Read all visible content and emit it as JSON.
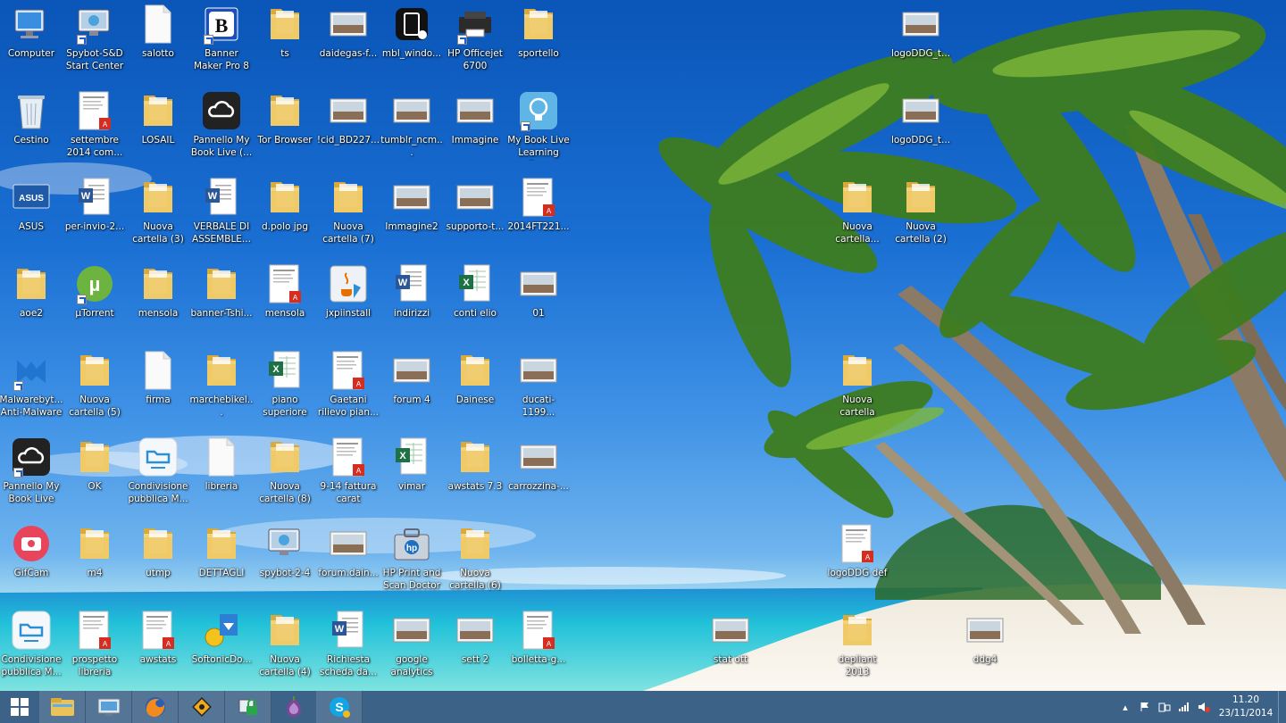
{
  "desktop_icons": [
    {
      "label": "Computer",
      "icon": "computer-icon",
      "shortcut": false
    },
    {
      "label": "Spybot-S&D Start Center",
      "icon": "spybot-icon",
      "shortcut": true
    },
    {
      "label": "salotto",
      "icon": "document-icon",
      "shortcut": false
    },
    {
      "label": "Banner Maker Pro 8",
      "icon": "banner-maker-icon",
      "shortcut": true
    },
    {
      "label": "ts",
      "icon": "folder-icon",
      "shortcut": false
    },
    {
      "label": "daidegas-f...",
      "icon": "image-icon",
      "shortcut": false
    },
    {
      "label": "mbl_windo...",
      "icon": "app-icon",
      "shortcut": false
    },
    {
      "label": "HP Officejet 6700",
      "icon": "printer-icon",
      "shortcut": true
    },
    {
      "label": "sportello",
      "icon": "folder-icon",
      "shortcut": false
    },
    {
      "label": "logoDDG_t...",
      "icon": "image-icon",
      "shortcut": false
    },
    {
      "label": "Cestino",
      "icon": "recycle-bin-icon",
      "shortcut": false
    },
    {
      "label": "settembre 2014 com...",
      "icon": "pdf-icon",
      "shortcut": false
    },
    {
      "label": "LOSAIL",
      "icon": "folder-icon",
      "shortcut": false
    },
    {
      "label": "Pannello My Book Live (...",
      "icon": "cloud-icon",
      "shortcut": false
    },
    {
      "label": "Tor Browser",
      "icon": "folder-icon",
      "shortcut": false
    },
    {
      "label": "!cid_BD227...",
      "icon": "image-icon",
      "shortcut": false
    },
    {
      "label": "tumblr_ncm...",
      "icon": "image-icon",
      "shortcut": false
    },
    {
      "label": "Immagine",
      "icon": "image-icon",
      "shortcut": false
    },
    {
      "label": "My Book Live Learning Ce...",
      "icon": "lightbulb-icon",
      "shortcut": true
    },
    {
      "label": "logoDDG_t...",
      "icon": "image-icon",
      "shortcut": false
    },
    {
      "label": "ASUS",
      "icon": "asus-icon",
      "shortcut": false
    },
    {
      "label": "per-invio-2...",
      "icon": "word-icon",
      "shortcut": false
    },
    {
      "label": "Nuova cartella (3)",
      "icon": "folder-icon",
      "shortcut": false
    },
    {
      "label": "VERBALE DI ASSEMBLE...",
      "icon": "word-icon",
      "shortcut": false
    },
    {
      "label": "d.polo jpg",
      "icon": "folder-icon",
      "shortcut": false
    },
    {
      "label": "Nuova cartella (7)",
      "icon": "folder-icon",
      "shortcut": false
    },
    {
      "label": "Immagine2",
      "icon": "image-icon",
      "shortcut": false
    },
    {
      "label": "supporto-t...",
      "icon": "image-icon",
      "shortcut": false
    },
    {
      "label": "2014FT221...",
      "icon": "pdf-icon",
      "shortcut": false
    },
    {
      "label": "Nuova cartella...",
      "icon": "folder-icon",
      "shortcut": false
    },
    {
      "label": "Nuova cartella (2)",
      "icon": "folder-icon",
      "shortcut": false
    },
    {
      "label": "aoe2",
      "icon": "folder-icon",
      "shortcut": false
    },
    {
      "label": "µTorrent",
      "icon": "utorrent-icon",
      "shortcut": true
    },
    {
      "label": "mensola",
      "icon": "folder-icon",
      "shortcut": false
    },
    {
      "label": "banner-Tshi...",
      "icon": "folder-icon",
      "shortcut": false
    },
    {
      "label": "mensola",
      "icon": "pdf-icon",
      "shortcut": false
    },
    {
      "label": "jxpiinstall",
      "icon": "java-icon",
      "shortcut": false
    },
    {
      "label": "indirizzi",
      "icon": "word-icon",
      "shortcut": false
    },
    {
      "label": "conti elio",
      "icon": "excel-icon",
      "shortcut": false
    },
    {
      "label": "01",
      "icon": "image-icon",
      "shortcut": false
    },
    {
      "label": "Malwarebyt... Anti-Malware",
      "icon": "malwarebytes-icon",
      "shortcut": true
    },
    {
      "label": "Nuova cartella (5)",
      "icon": "folder-icon",
      "shortcut": false
    },
    {
      "label": "firma",
      "icon": "blank-file-icon",
      "shortcut": false
    },
    {
      "label": "marchebikel...",
      "icon": "folder-icon",
      "shortcut": false
    },
    {
      "label": "piano superiore",
      "icon": "excel-icon",
      "shortcut": false
    },
    {
      "label": "Gaetani rilievo pian...",
      "icon": "pdf-icon",
      "shortcut": false
    },
    {
      "label": "forum 4",
      "icon": "image-icon",
      "shortcut": false
    },
    {
      "label": "Dainese",
      "icon": "folder-icon",
      "shortcut": false
    },
    {
      "label": "ducati-1199...",
      "icon": "image-icon",
      "shortcut": false
    },
    {
      "label": "Nuova cartella",
      "icon": "folder-icon",
      "shortcut": false
    },
    {
      "label": "Pannello My Book Live",
      "icon": "cloud-icon",
      "shortcut": true
    },
    {
      "label": "OK",
      "icon": "folder-icon",
      "shortcut": false
    },
    {
      "label": "Condivisione pubblica M...",
      "icon": "share-icon",
      "shortcut": false
    },
    {
      "label": "libreria",
      "icon": "blank-file-icon",
      "shortcut": false
    },
    {
      "label": "Nuova cartella (8)",
      "icon": "folder-icon",
      "shortcut": false
    },
    {
      "label": "9-14 fattura carat",
      "icon": "pdf-icon",
      "shortcut": false
    },
    {
      "label": "vimar",
      "icon": "excel-icon",
      "shortcut": false
    },
    {
      "label": "awstats 7.3",
      "icon": "folder-icon",
      "shortcut": false
    },
    {
      "label": "carrozzina-...",
      "icon": "image-icon",
      "shortcut": false
    },
    {
      "label": "GifCam",
      "icon": "camera-icon",
      "shortcut": false
    },
    {
      "label": "m4",
      "icon": "folder-icon",
      "shortcut": false
    },
    {
      "label": "utmp",
      "icon": "folder-icon",
      "shortcut": false
    },
    {
      "label": "DETTAGLI",
      "icon": "folder-icon",
      "shortcut": false
    },
    {
      "label": "spybot-2-4",
      "icon": "spybot-icon",
      "shortcut": false
    },
    {
      "label": "forum.dain...",
      "icon": "image-icon",
      "shortcut": false
    },
    {
      "label": "HP Print and Scan Doctor",
      "icon": "hp-doctor-icon",
      "shortcut": false
    },
    {
      "label": "Nuova cartella (6)",
      "icon": "folder-icon",
      "shortcut": false
    },
    {
      "label": "logoDDG def",
      "icon": "pdf-icon",
      "shortcut": false
    },
    {
      "label": "Condivisione pubblica M...",
      "icon": "share-icon",
      "shortcut": false
    },
    {
      "label": "prospetto libreria",
      "icon": "pdf-icon",
      "shortcut": false
    },
    {
      "label": "awstats",
      "icon": "pdf-icon",
      "shortcut": false
    },
    {
      "label": "SoftonicDo...",
      "icon": "softonic-icon",
      "shortcut": false
    },
    {
      "label": "Nuova cartella (4)",
      "icon": "folder-icon",
      "shortcut": false
    },
    {
      "label": "Richiesta scheda da...",
      "icon": "word-icon",
      "shortcut": false
    },
    {
      "label": "google analytics",
      "icon": "image-icon",
      "shortcut": false
    },
    {
      "label": "sett 2",
      "icon": "image-icon",
      "shortcut": false
    },
    {
      "label": "bolletta-g...",
      "icon": "pdf-icon",
      "shortcut": false
    },
    {
      "label": "stat ott",
      "icon": "image-icon",
      "shortcut": false
    },
    {
      "label": "depliant 2013",
      "icon": "folder-icon",
      "shortcut": false
    },
    {
      "label": "ddg4",
      "icon": "image-icon",
      "shortcut": false
    }
  ],
  "taskbar": {
    "start": "start-windows-icon",
    "pinned": [
      "file-explorer-icon",
      "control-panel-icon",
      "firefox-icon",
      "road-sign-icon",
      "security-lock-icon",
      "tor-onion-icon",
      "skype-icon"
    ]
  },
  "tray": {
    "time": "11.20",
    "date": "23/11/2014"
  },
  "colors": {
    "taskbar": "#3d6287",
    "sky": "#1a6fd3",
    "sea": "#2fc4d6",
    "sand": "#f2ece0"
  }
}
